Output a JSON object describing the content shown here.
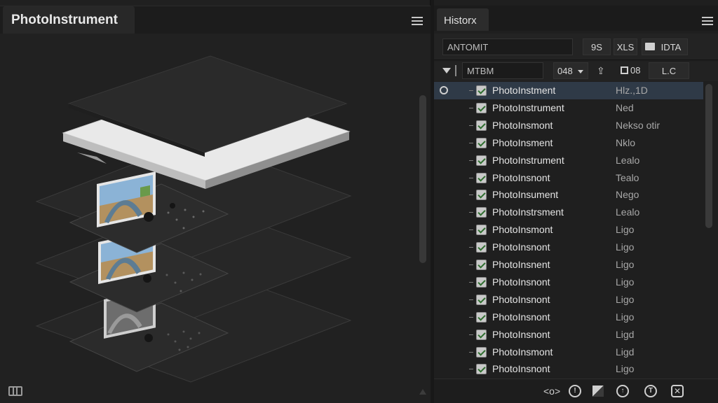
{
  "left_panel": {
    "title": "PhotoInstrument",
    "menu_icon": "hamburger-menu-icon",
    "panel_icon": "columns-icon"
  },
  "right_panel": {
    "tab_label": "Historx",
    "menu_icon": "hamburger-menu-icon",
    "toolbar1": {
      "field_value": "ANTOMIT",
      "btn1": "9S",
      "btn2": "XLS",
      "folder_icon": "folder-icon",
      "btn3": "IDTA"
    },
    "toolbar2": {
      "field_value": "MTBM",
      "dropdown_value": "048",
      "btn1": "08",
      "btn2": "L.C"
    },
    "rows": [
      {
        "name": "PhotoInstment",
        "value": "Hlz.,1D",
        "selected": true
      },
      {
        "name": "PhotoInstrument",
        "value": "Ned"
      },
      {
        "name": "PhotoInsmont",
        "value": "Nekso otir"
      },
      {
        "name": "PhotoInsment",
        "value": "Nklo"
      },
      {
        "name": "PhotoInstrument",
        "value": "Lealo"
      },
      {
        "name": "PhotoInsnont",
        "value": "Tealo"
      },
      {
        "name": "PhotoInsument",
        "value": "Nego"
      },
      {
        "name": "PhotoInstrsment",
        "value": "Lealo"
      },
      {
        "name": "PhotoInsmont",
        "value": "Ligo"
      },
      {
        "name": "PhotoInsnont",
        "value": "Ligo"
      },
      {
        "name": "PhotoInsnent",
        "value": "Ligo"
      },
      {
        "name": "PhotoInsnont",
        "value": "Ligo"
      },
      {
        "name": "PhotoInsnont",
        "value": "Ligo"
      },
      {
        "name": "PhotoInsnont",
        "value": "Ligo"
      },
      {
        "name": "PhotoInsnont",
        "value": "Ligd"
      },
      {
        "name": "PhotoInsmont",
        "value": "Ligd"
      },
      {
        "name": "PhotoInsnont",
        "value": "Ligo"
      }
    ],
    "bottom_icons": [
      "eye-toggle-icon",
      "info-icon",
      "mask-icon",
      "pin-icon",
      "text-icon",
      "close-icon"
    ]
  }
}
